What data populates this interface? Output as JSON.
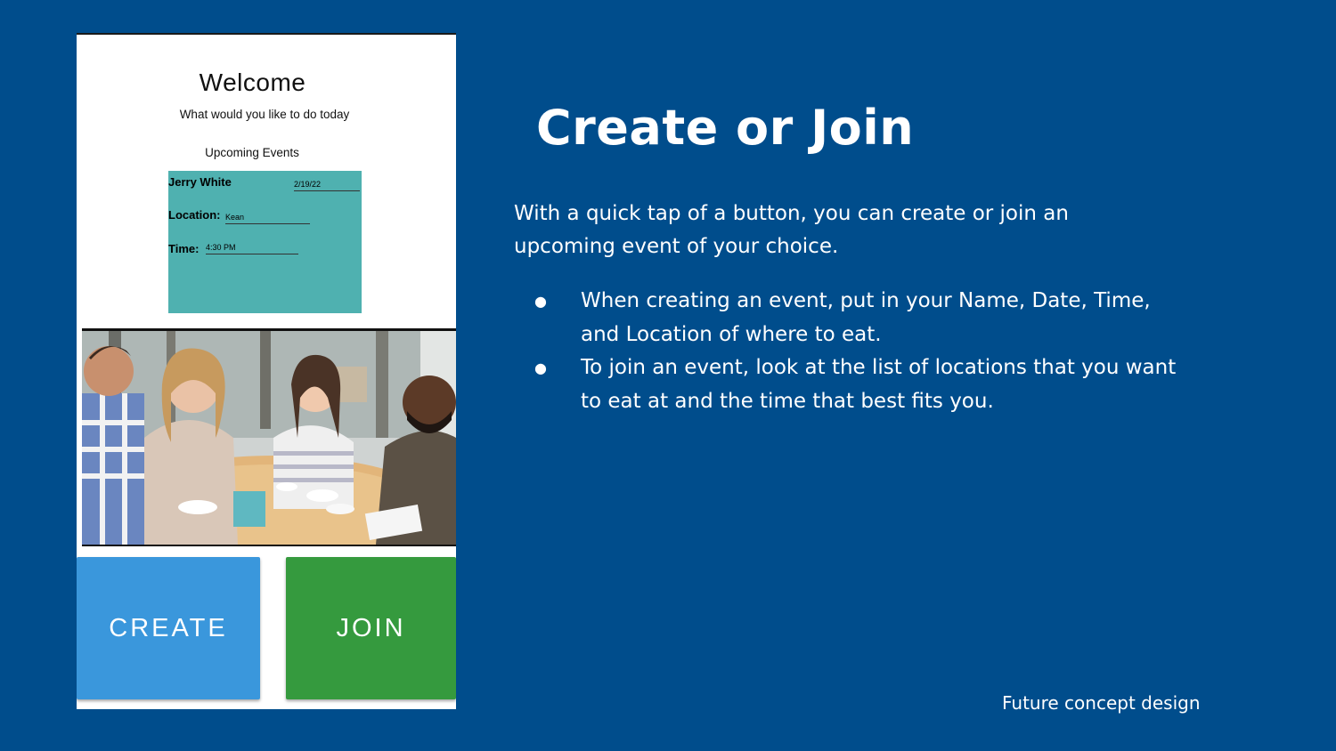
{
  "phone": {
    "welcome": "Welcome",
    "subtitle": "What would you like to do today",
    "upcoming_label": "Upcoming Events",
    "event": {
      "name": "Jerry White",
      "date": "2/19/22",
      "location_label": "Location:",
      "location_value": "Kean",
      "time_label": "Time:",
      "time_value": "4:30 PM"
    },
    "create_button": "CREATE",
    "join_button": "JOIN"
  },
  "slide": {
    "title": "Create or Join",
    "intro": "With a quick tap of a button, you can create or join an upcoming event of your choice.",
    "bullets": [
      "When creating an event, put in your Name, Date, Time, and Location of where to eat.",
      "To join an event, look at the list of locations that you want to eat at and the time that best fits you."
    ],
    "footer": "Future concept design"
  },
  "colors": {
    "background": "#004d8c",
    "event_card": "#4fb1b0",
    "create": "#3a97dc",
    "join": "#359a3e"
  }
}
